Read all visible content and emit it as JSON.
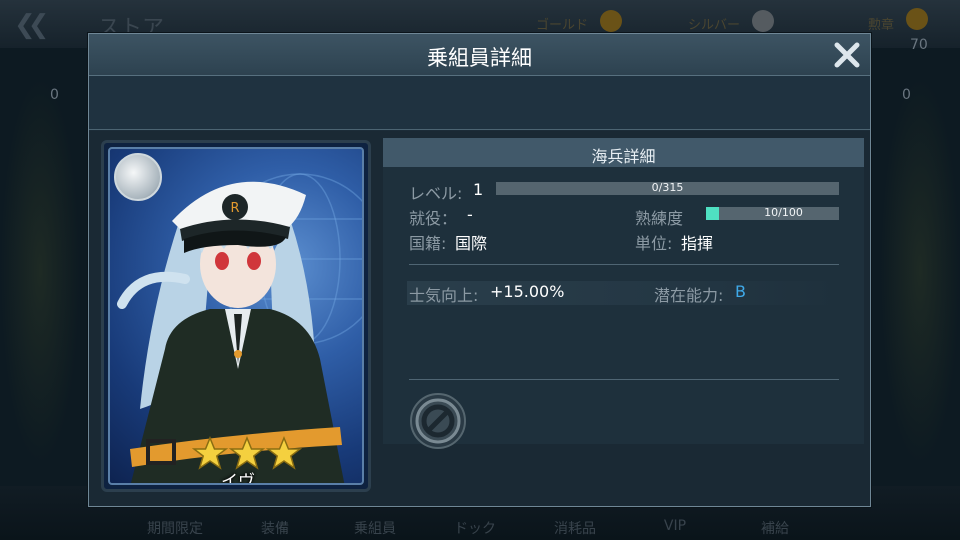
{
  "background": {
    "back_icon": "double-chevron-left-icon",
    "title": "ストア",
    "gold_label": "ゴールド",
    "silver_label": "シルバー",
    "right_label": "勲章",
    "right_value": "70",
    "left_count": "0",
    "right_count": "0",
    "tabs": [
      "期間限定",
      "装備",
      "乗組員",
      "ドック",
      "消耗品",
      "VIP",
      "補給"
    ]
  },
  "modal": {
    "title": "乗組員詳細",
    "close_icon": "close-icon"
  },
  "card": {
    "name": "イヴ",
    "stars": 3,
    "badge_icon": "rank-badge-icon"
  },
  "details": {
    "header": "海兵詳細",
    "level_label": "レベル:",
    "level_value": "1",
    "exp_text": "0/315",
    "exp_fraction": 0,
    "service_label": "就役：",
    "service_value": "-",
    "mastery_label": "熟練度",
    "mastery_text": "10/100",
    "mastery_fraction": 0.1,
    "nationality_label": "国籍:",
    "nationality_value": "国際",
    "unit_label": "単位:",
    "unit_value": "指揮",
    "morale_label": "士気向上:",
    "morale_value": "+15.00%",
    "potential_label": "潜在能力:",
    "potential_value": "B",
    "potential_color": "#3fa9e8",
    "skill_icon": "locked-skill-icon"
  }
}
